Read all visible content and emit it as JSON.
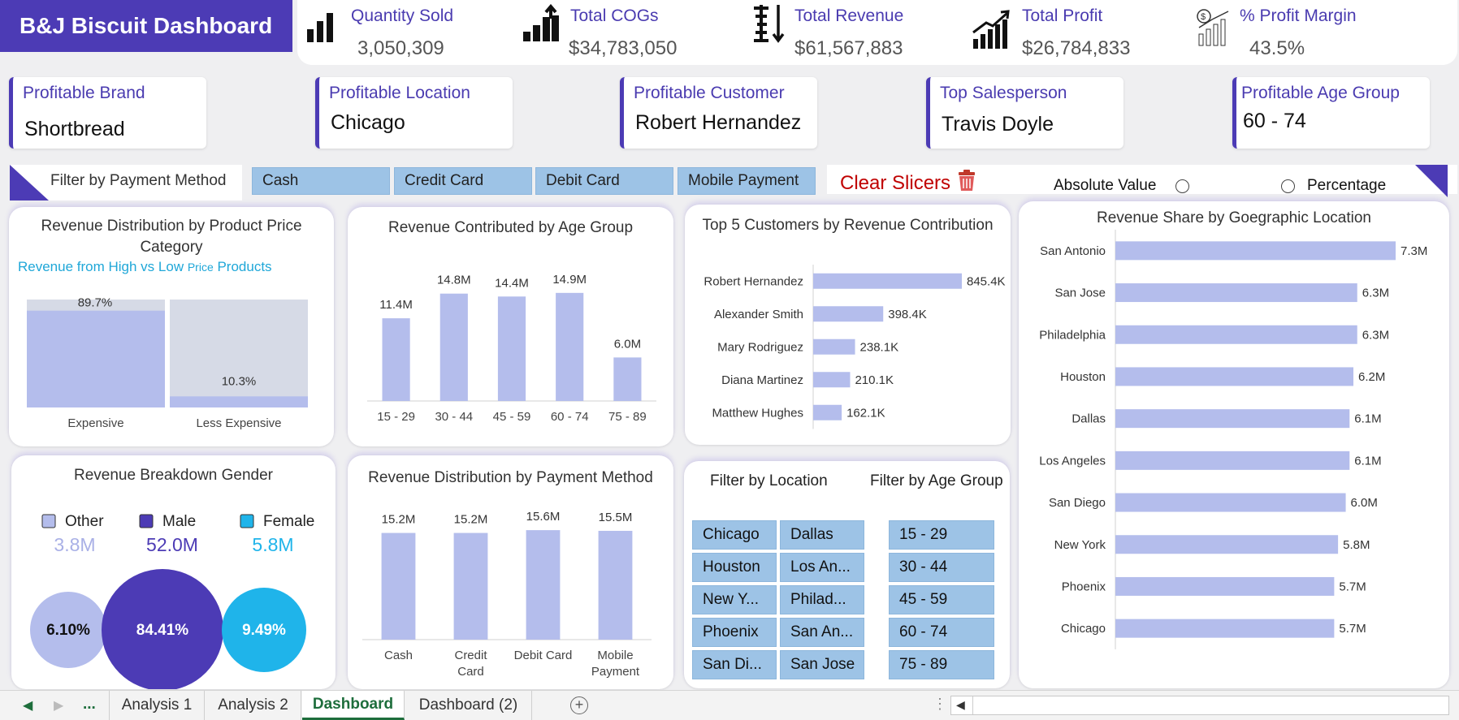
{
  "dashboard_title": "B&J Biscuit Dashboard",
  "kpis": [
    {
      "label": "Quantity Sold",
      "value": "3,050,309",
      "icon": "bar-chart-icon"
    },
    {
      "label": "Total COGs",
      "value": "$34,783,050",
      "icon": "growth-bars-icon"
    },
    {
      "label": "Total Revenue",
      "value": "$61,567,883",
      "icon": "sort-descending-icon"
    },
    {
      "label": "Total Profit",
      "value": "$26,784,833",
      "icon": "trending-up-bars-icon"
    },
    {
      "label": "% Profit Margin",
      "value": "43.5%",
      "icon": "money-growth-icon"
    }
  ],
  "cards": [
    {
      "label": "Profitable Brand",
      "value": "Shortbread"
    },
    {
      "label": "Profitable Location",
      "value": "Chicago"
    },
    {
      "label": "Profitable Customer",
      "value": "Robert Hernandez"
    },
    {
      "label": "Top Salesperson",
      "value": "Travis Doyle"
    },
    {
      "label": "Profitable Age Group",
      "value": "60 - 74"
    }
  ],
  "payment_filter": {
    "label": "Filter by Payment Method",
    "options": [
      "Cash",
      "Credit Card",
      "Debit Card",
      "Mobile Payment"
    ]
  },
  "clear_slicers": "Clear Slicers",
  "toggle": {
    "absolute": "Absolute Value",
    "percentage": "Percentage"
  },
  "colors": {
    "accent": "#4c3bb5",
    "bar": "#b4bdec",
    "slicer": "#9dc3e6",
    "cyan": "#1fb4ea",
    "clear": "#c00000"
  },
  "price_panel": {
    "title": "Revenue Distribution by Product Price Category",
    "subtitle_main": "Revenue from High vs Low ",
    "subtitle_small": "Price",
    "subtitle_end": " Products"
  },
  "gender_panel": {
    "title": "Revenue Breakdown Gender",
    "legend": [
      {
        "name": "Other",
        "value": "3.8M"
      },
      {
        "name": "Male",
        "value": "52.0M"
      },
      {
        "name": "Female",
        "value": "5.8M"
      }
    ]
  },
  "location_filter": {
    "label": "Filter by Location",
    "items": [
      "Chicago",
      "Dallas",
      "Houston",
      "Los An...",
      "New Y...",
      "Philad...",
      "Phoenix",
      "San An...",
      "San Di...",
      "San Jose"
    ]
  },
  "age_filter": {
    "label": "Filter by Age Group",
    "items": [
      "15 - 29",
      "30 - 44",
      "45 - 59",
      "60 - 74",
      "75 - 89"
    ]
  },
  "tabs": {
    "ellipsis": "...",
    "items": [
      "Analysis 1",
      "Analysis 2",
      "Dashboard",
      "Dashboard (2)"
    ],
    "active": "Dashboard"
  },
  "chart_data": [
    {
      "id": "price",
      "type": "bar",
      "title": "Revenue Distribution by Product Price Category",
      "categories": [
        "Expensive",
        "Less Expensive"
      ],
      "values": [
        89.7,
        10.3
      ],
      "labels": [
        "89.7%",
        "10.3%"
      ],
      "ylim": [
        0,
        100
      ]
    },
    {
      "id": "age",
      "type": "bar",
      "title": "Revenue Contributed by Age Group",
      "categories": [
        "15 - 29",
        "30 - 44",
        "45 - 59",
        "60 - 74",
        "75 - 89"
      ],
      "values": [
        11.4,
        14.8,
        14.4,
        14.9,
        6.0
      ],
      "labels": [
        "11.4M",
        "14.8M",
        "14.4M",
        "14.9M",
        "6.0M"
      ],
      "ylim": [
        0,
        16
      ]
    },
    {
      "id": "customers",
      "type": "bar",
      "title": "Top 5 Customers by Revenue Contribution",
      "categories": [
        "Robert Hernandez",
        "Alexander Smith",
        "Mary Rodriguez",
        "Diana Martinez",
        "Matthew Hughes"
      ],
      "values": [
        845.4,
        398.4,
        238.1,
        210.1,
        162.1
      ],
      "labels": [
        "845.4K",
        "398.4K",
        "238.1K",
        "210.1K",
        "162.1K"
      ]
    },
    {
      "id": "location",
      "type": "bar",
      "title": "Revenue Share by Goegraphic Location",
      "categories": [
        "San Antonio",
        "San Jose",
        "Philadelphia",
        "Houston",
        "Dallas",
        "Los Angeles",
        "San Diego",
        "New York",
        "Phoenix",
        "Chicago"
      ],
      "values": [
        7.3,
        6.3,
        6.3,
        6.2,
        6.1,
        6.1,
        6.0,
        5.8,
        5.7,
        5.7
      ],
      "labels": [
        "7.3M",
        "6.3M",
        "6.3M",
        "6.2M",
        "6.1M",
        "6.1M",
        "6.0M",
        "5.8M",
        "5.7M",
        "5.7M"
      ]
    },
    {
      "id": "payment",
      "type": "bar",
      "title": "Revenue Distribution by Payment Method",
      "categories": [
        "Cash",
        "Credit Card",
        "Debit Card",
        "Mobile Payment"
      ],
      "values": [
        15.2,
        15.2,
        15.6,
        15.5
      ],
      "labels": [
        "15.2M",
        "15.2M",
        "15.6M",
        "15.5M"
      ],
      "ylim": [
        0,
        17
      ]
    },
    {
      "id": "gender",
      "type": "pie",
      "title": "Revenue Breakdown Gender",
      "categories": [
        "Other",
        "Male",
        "Female"
      ],
      "values": [
        6.1,
        84.41,
        9.49
      ],
      "labels": [
        "6.10%",
        "84.41%",
        "9.49%"
      ]
    }
  ]
}
